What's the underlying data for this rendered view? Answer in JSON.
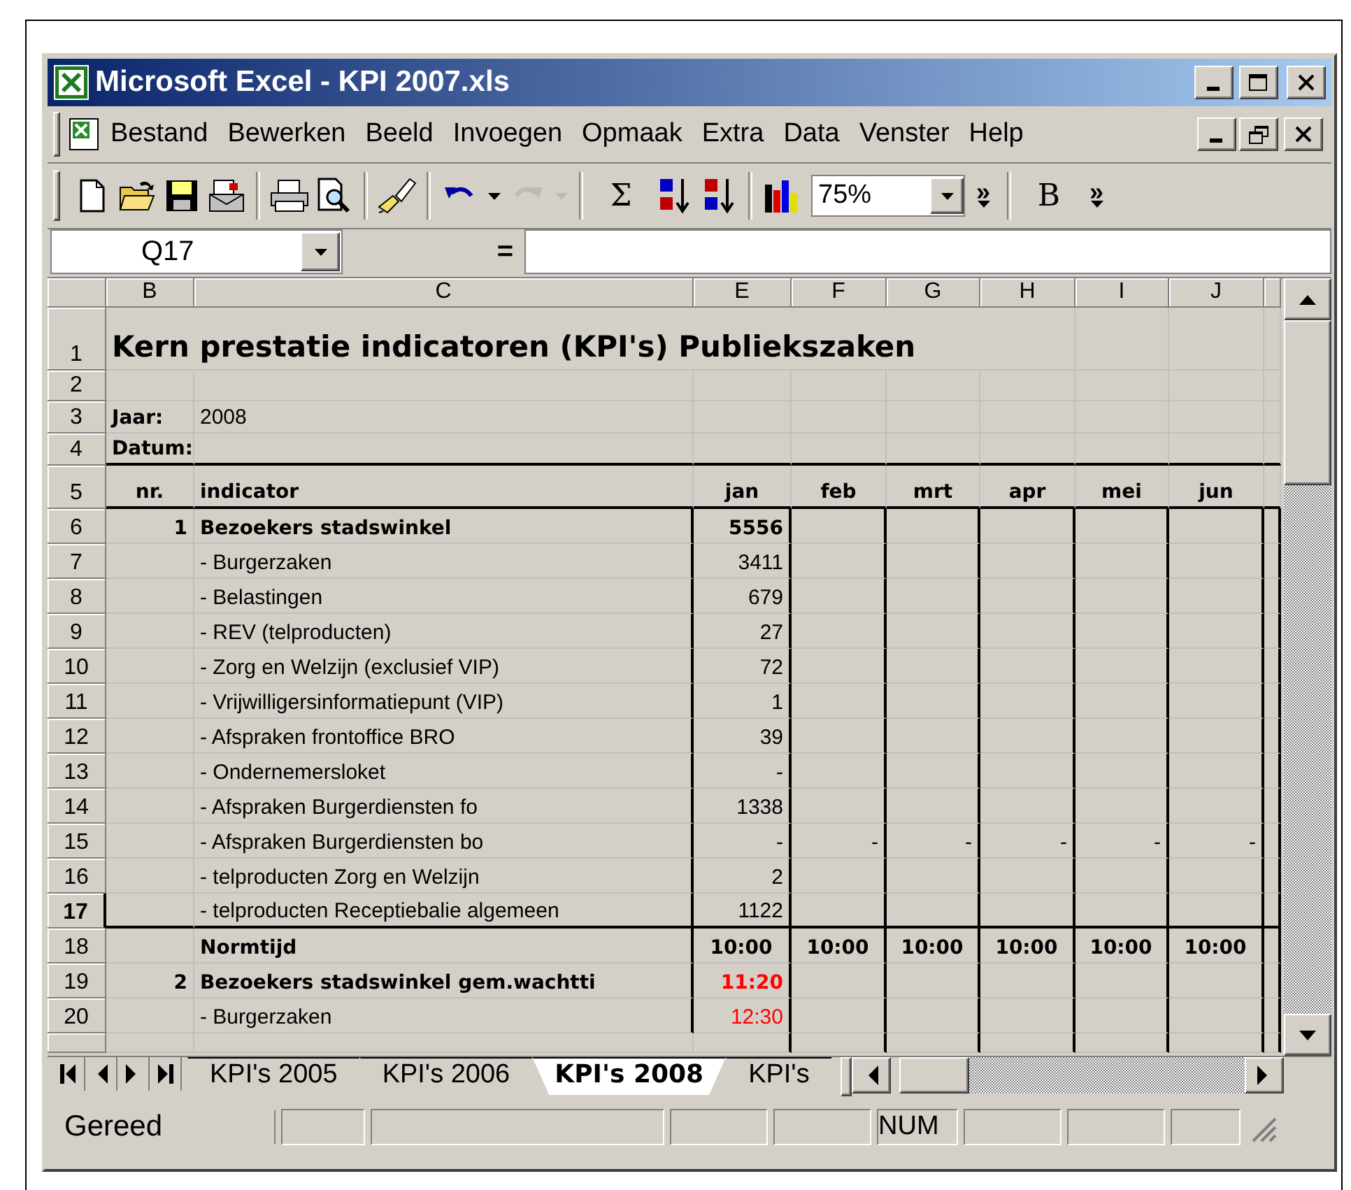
{
  "window": {
    "title": "Microsoft Excel - KPI 2007.xls"
  },
  "menu": [
    "Bestand",
    "Bewerken",
    "Beeld",
    "Invoegen",
    "Opmaak",
    "Extra",
    "Data",
    "Venster",
    "Help"
  ],
  "toolbar": [
    [
      {
        "kind": "new",
        "disabled": false
      },
      {
        "kind": "open",
        "disabled": false
      },
      {
        "kind": "save",
        "disabled": false
      },
      {
        "kind": "mail",
        "disabled": false
      }
    ],
    [
      {
        "kind": "print",
        "disabled": false
      },
      {
        "kind": "preview",
        "disabled": false
      }
    ],
    [
      {
        "kind": "brush",
        "disabled": false
      }
    ],
    [
      {
        "kind": "undo",
        "disabled": false
      },
      {
        "kind": "dropdown",
        "disabled": false
      },
      {
        "kind": "redo",
        "disabled": true
      },
      {
        "kind": "dropdown",
        "disabled": true
      }
    ],
    [
      {
        "kind": "text",
        "label": "Σ",
        "disabled": false
      },
      {
        "kind": "sort_asc",
        "disabled": false
      },
      {
        "kind": "sort_desc",
        "disabled": false
      }
    ],
    [
      {
        "kind": "chart",
        "disabled": false
      },
      {
        "kind": "combo",
        "value": "75%",
        "disabled": false
      },
      {
        "kind": "more",
        "label": "»",
        "disabled": false
      }
    ],
    [
      {
        "kind": "text",
        "label": "B",
        "disabled": false
      },
      {
        "kind": "more",
        "label": "»",
        "disabled": false
      }
    ]
  ],
  "formula_bar": {
    "name_box": "Q17",
    "equals": "="
  },
  "sheet": {
    "columns": [
      "B",
      "C",
      "E",
      "F",
      "G",
      "H",
      "I",
      "J"
    ],
    "rows": [
      {
        "number": "1",
        "kind": "title",
        "selected": false,
        "rule_below": false,
        "cells": [
          "Kern prestatie indicatoren (KPI's) Publiekszaken",
          null,
          null,
          null,
          null,
          null,
          null,
          null
        ]
      },
      {
        "number": "2",
        "kind": "blank",
        "selected": false,
        "rule_below": false,
        "cells": [
          null,
          null,
          null,
          null,
          null,
          null,
          null,
          null
        ]
      },
      {
        "number": "3",
        "kind": "meta",
        "selected": false,
        "rule_below": false,
        "cells": [
          "Jaar:",
          "2008",
          null,
          null,
          null,
          null,
          null,
          null
        ]
      },
      {
        "number": "4",
        "kind": "meta",
        "selected": false,
        "rule_below": true,
        "cells": [
          "Datum:",
          null,
          null,
          null,
          null,
          null,
          null,
          null
        ]
      },
      {
        "number": "5",
        "kind": "header",
        "selected": false,
        "rule_below": true,
        "cells": [
          "nr.",
          "indicator",
          "jan",
          "feb",
          "mrt",
          "apr",
          "mei",
          "jun"
        ]
      },
      {
        "number": "6",
        "kind": "group",
        "selected": false,
        "rule_below": false,
        "cells": [
          "1",
          "Bezoekers stadswinkel",
          "5556",
          null,
          null,
          null,
          null,
          null
        ]
      },
      {
        "number": "7",
        "kind": "item",
        "selected": false,
        "rule_below": false,
        "cells": [
          null,
          "- Burgerzaken",
          "3411",
          null,
          null,
          null,
          null,
          null
        ]
      },
      {
        "number": "8",
        "kind": "item",
        "selected": false,
        "rule_below": false,
        "cells": [
          null,
          "- Belastingen",
          "679",
          null,
          null,
          null,
          null,
          null
        ]
      },
      {
        "number": "9",
        "kind": "item",
        "selected": false,
        "rule_below": false,
        "cells": [
          null,
          "- REV (telproducten)",
          "27",
          null,
          null,
          null,
          null,
          null
        ]
      },
      {
        "number": "10",
        "kind": "item",
        "selected": false,
        "rule_below": false,
        "cells": [
          null,
          "- Zorg en Welzijn (exclusief VIP)",
          "72",
          null,
          null,
          null,
          null,
          null
        ]
      },
      {
        "number": "11",
        "kind": "item",
        "selected": false,
        "rule_below": false,
        "cells": [
          null,
          "- Vrijwilligersinformatiepunt (VIP)",
          "1",
          null,
          null,
          null,
          null,
          null
        ]
      },
      {
        "number": "12",
        "kind": "item",
        "selected": false,
        "rule_below": false,
        "cells": [
          null,
          "- Afspraken frontoffice BRO",
          "39",
          null,
          null,
          null,
          null,
          null
        ]
      },
      {
        "number": "13",
        "kind": "item",
        "selected": false,
        "rule_below": false,
        "cells": [
          null,
          "- Ondernemersloket",
          "-",
          null,
          null,
          null,
          null,
          null
        ]
      },
      {
        "number": "14",
        "kind": "item",
        "selected": false,
        "rule_below": false,
        "cells": [
          null,
          "- Afspraken Burgerdiensten fo",
          "1338",
          null,
          null,
          null,
          null,
          null
        ]
      },
      {
        "number": "15",
        "kind": "item",
        "selected": false,
        "rule_below": false,
        "cells": [
          null,
          "- Afspraken Burgerdiensten bo",
          "-",
          "-",
          "-",
          "-",
          "-",
          "-"
        ]
      },
      {
        "number": "16",
        "kind": "item",
        "selected": false,
        "rule_below": false,
        "cells": [
          null,
          "- telproducten Zorg en Welzijn",
          "2",
          null,
          null,
          null,
          null,
          null
        ]
      },
      {
        "number": "17",
        "kind": "item",
        "selected": true,
        "rule_below": true,
        "cells": [
          null,
          "- telproducten Receptiebalie algemeen",
          "1122",
          null,
          null,
          null,
          null,
          null
        ]
      },
      {
        "number": "18",
        "kind": "norm",
        "selected": false,
        "rule_below": false,
        "cells": [
          null,
          "Normtijd",
          "10:00",
          "10:00",
          "10:00",
          "10:00",
          "10:00",
          "10:00"
        ]
      },
      {
        "number": "19",
        "kind": "wait",
        "selected": false,
        "rule_below": false,
        "cells": [
          "2",
          "Bezoekers stadswinkel gem.wachtti",
          "11:20",
          null,
          null,
          null,
          null,
          null
        ]
      },
      {
        "number": "20",
        "kind": "subwait",
        "selected": false,
        "rule_below": false,
        "cells": [
          null,
          "- Burgerzaken",
          "12:30",
          null,
          null,
          null,
          null,
          null
        ]
      }
    ]
  },
  "sheet_tabs": [
    {
      "label": "KPI's 2005",
      "selected": false
    },
    {
      "label": "KPI's 2006",
      "selected": false
    },
    {
      "label": "KPI's 2008",
      "selected": true
    },
    {
      "label": "KPI's",
      "selected": false
    }
  ],
  "status_bar": {
    "message": "Gereed",
    "indicator": "NUM"
  }
}
